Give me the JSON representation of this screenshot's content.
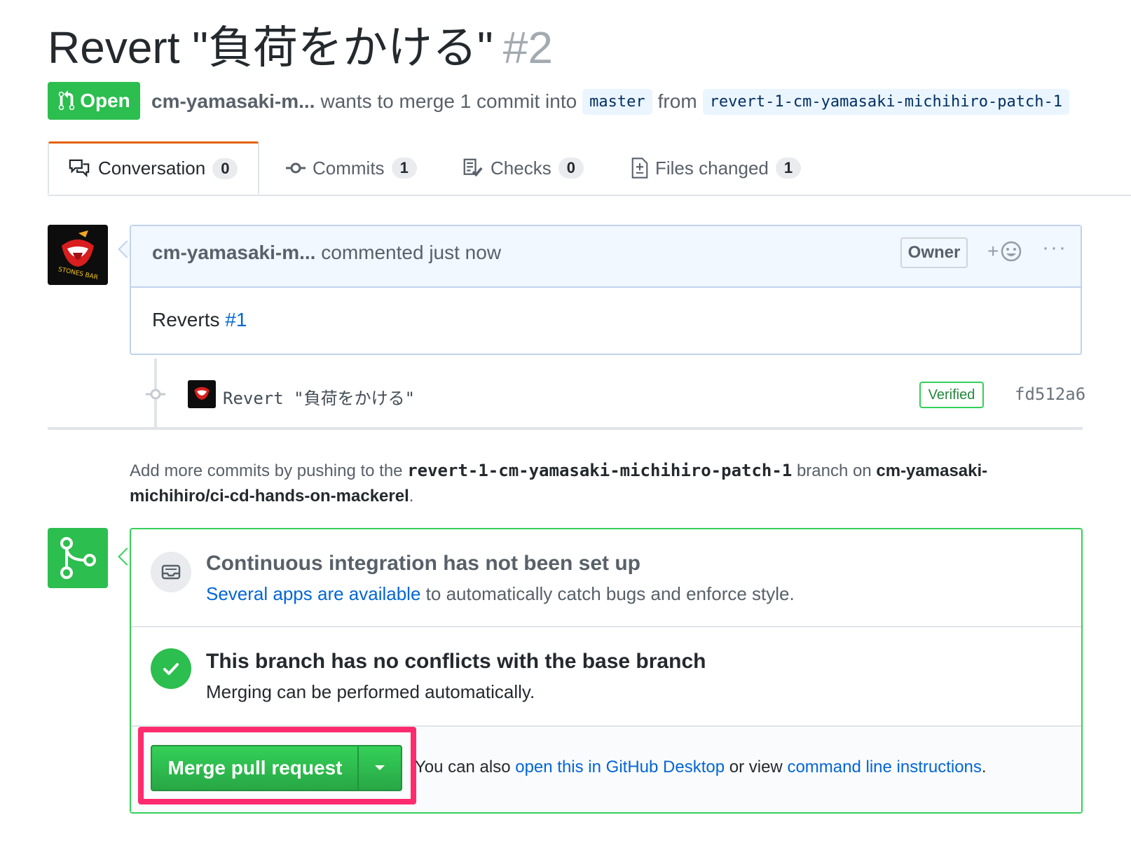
{
  "pr": {
    "title": "Revert \"負荷をかける\"",
    "number": "#2",
    "state": "Open",
    "author": "cm-yamasaki-m...",
    "merge_text": "wants to merge 1 commit into",
    "base_branch": "master",
    "from_text": "from",
    "head_branch": "revert-1-cm-yamasaki-michihiro-patch-1"
  },
  "tabs": [
    {
      "label": "Conversation",
      "count": "0",
      "icon": "comment-discussion-icon"
    },
    {
      "label": "Commits",
      "count": "1",
      "icon": "git-commit-icon"
    },
    {
      "label": "Checks",
      "count": "0",
      "icon": "checklist-icon"
    },
    {
      "label": "Files changed",
      "count": "1",
      "icon": "diff-icon"
    }
  ],
  "comment": {
    "author": "cm-yamasaki-m...",
    "action": "commented just now",
    "badge": "Owner",
    "reaction_plus": "+",
    "more": "···",
    "body_prefix": "Reverts",
    "body_link": "#1"
  },
  "commit": {
    "message": "Revert \"負荷をかける\"",
    "verified": "Verified",
    "sha": "fd512a6"
  },
  "notice": {
    "prefix": "Add more commits by pushing to the",
    "branch": "revert-1-cm-yamasaki-michihiro-patch-1",
    "middle": "branch on",
    "repo": "cm-yamasaki-michihiro/ci-cd-hands-on-mackerel",
    "suffix": "."
  },
  "merge": {
    "ci_title": "Continuous integration has not been set up",
    "ci_link": "Several apps are available",
    "ci_rest": "to automatically catch bugs and enforce style.",
    "conflict_title": "This branch has no conflicts with the base branch",
    "conflict_desc": "Merging can be performed automatically.",
    "button": "Merge pull request",
    "also_prefix": "You can also",
    "desktop_link": "open this in GitHub Desktop",
    "or_view": "or view",
    "cli_link": "command line instructions",
    "period": "."
  },
  "colors": {
    "open_green": "#2cbe4e",
    "link_blue": "#0366d6",
    "highlight_pink": "#ff2b6e"
  }
}
